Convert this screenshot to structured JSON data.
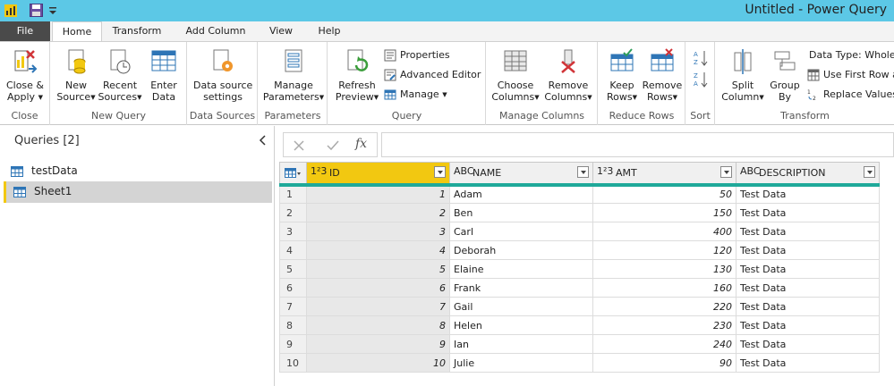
{
  "window": {
    "title": "Untitled - Power Query"
  },
  "tabs": [
    "File",
    "Home",
    "Transform",
    "Add Column",
    "View",
    "Help"
  ],
  "ribbon": {
    "groups": {
      "close": "Close",
      "new_query": "New Query",
      "data_sources": "Data Sources",
      "parameters": "Parameters",
      "query": "Query",
      "manage_columns": "Manage Columns",
      "reduce_rows": "Reduce Rows",
      "sort": "Sort",
      "transform": "Transform"
    },
    "buttons": {
      "close_apply_1": "Close &",
      "close_apply_2": "Apply",
      "new_source_1": "New",
      "new_source_2": "Source",
      "recent_sources_1": "Recent",
      "recent_sources_2": "Sources",
      "enter_data_1": "Enter",
      "enter_data_2": "Data",
      "ds_settings_1": "Data source",
      "ds_settings_2": "settings",
      "manage_params_1": "Manage",
      "manage_params_2": "Parameters",
      "refresh_1": "Refresh",
      "refresh_2": "Preview",
      "properties": "Properties",
      "advanced_editor": "Advanced Editor",
      "manage": "Manage",
      "choose_columns_1": "Choose",
      "choose_columns_2": "Columns",
      "remove_columns_1": "Remove",
      "remove_columns_2": "Columns",
      "keep_rows_1": "Keep",
      "keep_rows_2": "Rows",
      "remove_rows_1": "Remove",
      "remove_rows_2": "Rows",
      "split_column_1": "Split",
      "split_column_2": "Column",
      "group_by_1": "Group",
      "group_by_2": "By",
      "data_type": "Data Type: Whole N",
      "first_row": "Use First Row a",
      "replace_values": "Replace Values"
    }
  },
  "queries": {
    "header": "Queries [2]",
    "items": [
      "testData",
      "Sheet1"
    ],
    "selected": "Sheet1"
  },
  "formula": {
    "fx": "fx",
    "value": ""
  },
  "table": {
    "columns": [
      {
        "type": "1²3",
        "name": "ID"
      },
      {
        "type": "ABC",
        "name": "NAME"
      },
      {
        "type": "1²3",
        "name": "AMT"
      },
      {
        "type": "ABC",
        "name": "DESCRIPTION"
      }
    ],
    "rows": [
      [
        "1",
        "1",
        "Adam",
        "50",
        "Test Data"
      ],
      [
        "2",
        "2",
        "Ben",
        "150",
        "Test Data"
      ],
      [
        "3",
        "3",
        "Carl",
        "400",
        "Test Data"
      ],
      [
        "4",
        "4",
        "Deborah",
        "120",
        "Test Data"
      ],
      [
        "5",
        "5",
        "Elaine",
        "130",
        "Test Data"
      ],
      [
        "6",
        "6",
        "Frank",
        "160",
        "Test Data"
      ],
      [
        "7",
        "7",
        "Gail",
        "220",
        "Test Data"
      ],
      [
        "8",
        "8",
        "Helen",
        "230",
        "Test Data"
      ],
      [
        "9",
        "9",
        "Ian",
        "240",
        "Test Data"
      ],
      [
        "10",
        "10",
        "Julie",
        "90",
        "Test Data"
      ]
    ]
  },
  "colors": {
    "titlebar": "#5cc8e6",
    "accent_yellow": "#f2c811",
    "column_quality_bar": "#1fa99a"
  }
}
